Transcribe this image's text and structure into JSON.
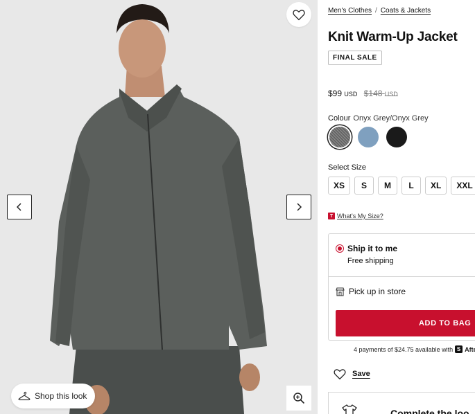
{
  "gallery": {
    "favourite_icon": "heart-outline-icon",
    "prev_icon": "chevron-left-icon",
    "next_icon": "chevron-right-icon",
    "shop_look_label": "Shop this look",
    "shop_look_icon": "hanger-icon",
    "zoom_icon": "zoom-in-icon"
  },
  "breadcrumb": {
    "items": [
      "Men's Clothes",
      "Coats & Jackets"
    ],
    "separator": "/"
  },
  "product": {
    "title": "Knit Warm-Up Jacket",
    "badge": "FINAL SALE",
    "price": "$99",
    "price_currency": "USD",
    "original_price": "$148",
    "original_currency": "USD"
  },
  "colour": {
    "label": "Colour",
    "selected": "Onyx Grey/Onyx Grey",
    "swatches": [
      {
        "name": "Onyx Grey/Onyx Grey",
        "color": "#6e6e6e",
        "selected": true
      },
      {
        "name": "blue",
        "color": "#7fa0bf",
        "selected": false
      },
      {
        "name": "black",
        "color": "#1a1a1a",
        "selected": false
      }
    ]
  },
  "size": {
    "label": "Select Size",
    "options": [
      "XS",
      "S",
      "M",
      "L",
      "XL",
      "XXL"
    ]
  },
  "size_guide": {
    "logo": "T",
    "label": "What's My Size?"
  },
  "fulfilment": {
    "ship_title": "Ship it to me",
    "ship_sub": "Free shipping",
    "pickup": "Pick up in store",
    "pickup_icon": "store-icon",
    "add_to_bag": "ADD TO BAG"
  },
  "afterpay": {
    "text": "4 payments of $24.75 available with",
    "logo": "S",
    "brand": "Afte"
  },
  "save": {
    "label": "Save",
    "icon": "heart-outline-icon"
  },
  "complete": {
    "label": "Complete the loo",
    "icon": "shirt-icon"
  },
  "colors": {
    "accent": "#c8102e",
    "border": "#d6d6d6"
  }
}
